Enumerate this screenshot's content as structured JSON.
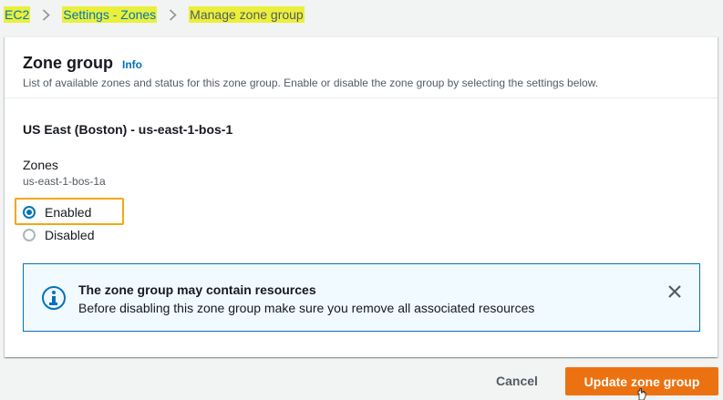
{
  "breadcrumb": {
    "items": [
      "EC2",
      "Settings - Zones",
      "Manage zone group"
    ]
  },
  "panel": {
    "title": "Zone group",
    "info_link": "Info",
    "description": "List of available zones and status for this zone group. Enable or disable the zone group by selecting the settings below."
  },
  "zone_group": {
    "name": "US East (Boston) - us-east-1-bos-1",
    "zones_label": "Zones",
    "zones_value": "us-east-1-bos-1a"
  },
  "status_options": {
    "selected": "Enabled",
    "enabled_label": "Enabled",
    "disabled_label": "Disabled"
  },
  "alert": {
    "title": "The zone group may contain resources",
    "body": "Before disabling this zone group make sure you remove all associated resources",
    "icon": "info-icon",
    "close_icon": "close-icon"
  },
  "actions": {
    "cancel_label": "Cancel",
    "update_label": "Update zone group"
  },
  "colors": {
    "accent": "#0073bb",
    "primary_button": "#ec7211",
    "highlight": "#eaf03a",
    "focus_box": "#f3a712"
  }
}
